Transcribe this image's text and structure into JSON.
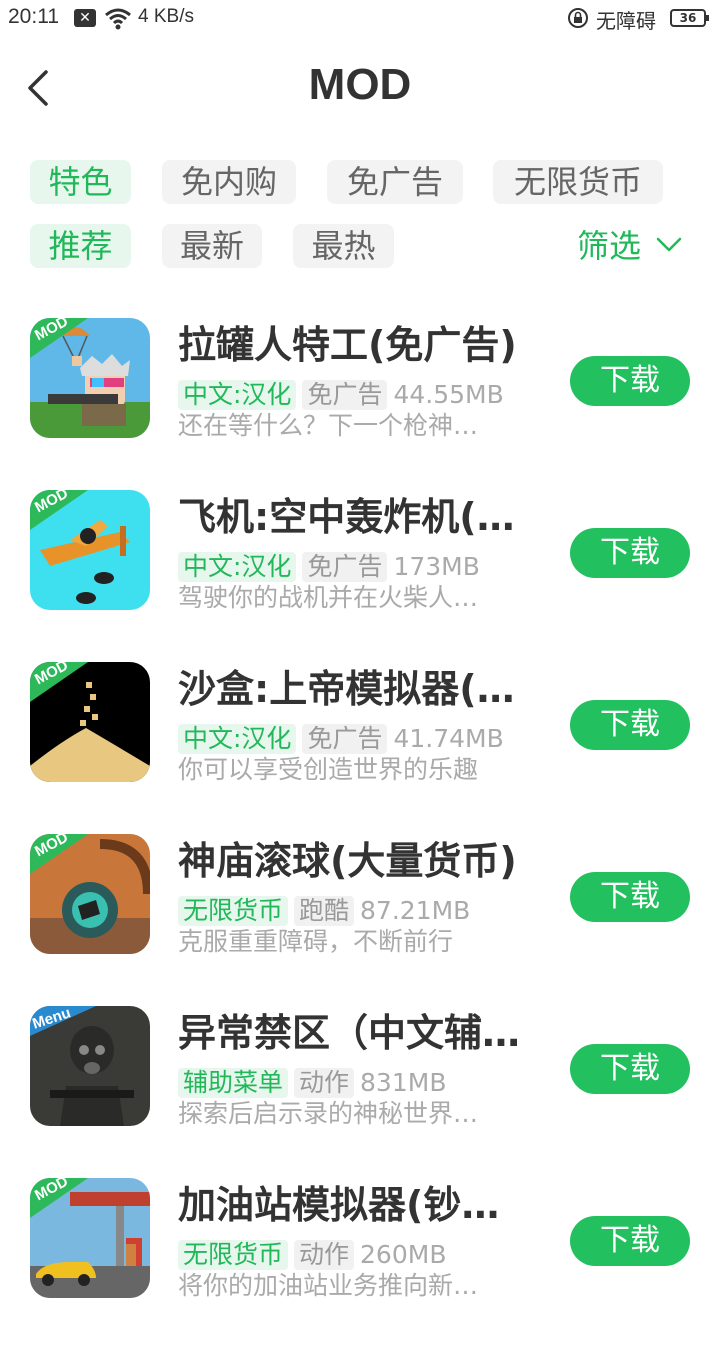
{
  "status_bar": {
    "time": "20:11",
    "network_speed": "4 KB/s",
    "accessibility": "无障碍",
    "battery": "36"
  },
  "header": {
    "title": "MOD"
  },
  "filters": {
    "row1": [
      "特色",
      "免内购",
      "免广告",
      "无限货币"
    ],
    "row2": [
      "推荐",
      "最新",
      "最热"
    ],
    "active": [
      "特色",
      "推荐"
    ],
    "filter_label": "筛选"
  },
  "apps": [
    {
      "name": "拉罐人特工(免广告)",
      "tag1": "中文:汉化",
      "tag2": "免广告",
      "size": "44.55MB",
      "desc": "还在等什么？下一个枪神…",
      "button": "下载",
      "badge": "MOD",
      "icon": "soldier-parachute-icon"
    },
    {
      "name": "飞机:空中轰炸机(…",
      "tag1": "中文:汉化",
      "tag2": "免广告",
      "size": "173MB",
      "desc": "驾驶你的战机并在火柴人…",
      "button": "下载",
      "badge": "MOD",
      "icon": "bomber-plane-icon"
    },
    {
      "name": "沙盒:上帝模拟器(…",
      "tag1": "中文:汉化",
      "tag2": "免广告",
      "size": "41.74MB",
      "desc": "你可以享受创造世界的乐趣",
      "button": "下载",
      "badge": "MOD",
      "icon": "sand-pile-icon"
    },
    {
      "name": "神庙滚球(大量货币)",
      "tag1": "无限货币",
      "tag2": "跑酷",
      "size": "87.21MB",
      "desc": "克服重重障碍，不断前行",
      "button": "下载",
      "badge": "MOD",
      "icon": "rolling-ball-icon"
    },
    {
      "name": "异常禁区（中文辅…",
      "tag1": "辅助菜单",
      "tag2": "动作",
      "size": "831MB",
      "desc": "探索后启示录的神秘世界…",
      "button": "下载",
      "badge": "Menu",
      "icon": "gas-mask-soldier-icon"
    },
    {
      "name": "加油站模拟器(钞…",
      "tag1": "无限货币",
      "tag2": "动作",
      "size": "260MB",
      "desc": "将你的加油站业务推向新…",
      "button": "下载",
      "badge": "MOD",
      "icon": "gas-station-icon"
    }
  ],
  "colors": {
    "accent": "#22c05f",
    "accent_text": "#22b85a",
    "chip_active_bg": "#e8f7ee",
    "chip_bg": "#f3f3f3"
  }
}
